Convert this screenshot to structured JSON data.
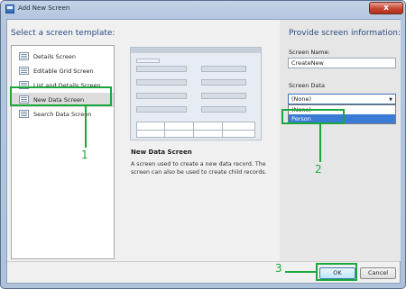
{
  "window": {
    "title": "Add New Screen",
    "close_label": "x"
  },
  "left": {
    "header": "Select a screen template:",
    "templates": [
      {
        "label": "Details Screen",
        "icon": "details-screen-icon"
      },
      {
        "label": "Editable Grid Screen",
        "icon": "grid-screen-icon"
      },
      {
        "label": "List and Details Screen",
        "icon": "list-details-icon"
      },
      {
        "label": "New Data Screen",
        "icon": "new-data-icon"
      },
      {
        "label": "Search Data Screen",
        "icon": "search-data-icon"
      }
    ],
    "selected_index": 3
  },
  "description": {
    "title": "New Data Screen",
    "text": "A screen used to create a new data record.  The screen can also be used to create child records."
  },
  "right": {
    "header": "Provide screen information:",
    "screen_name_label": "Screen Name:",
    "screen_name_value": "CreateNew",
    "screen_data_label": "Screen Data",
    "screen_data_value": "(None)",
    "screen_data_options": [
      "(None)",
      "Person"
    ],
    "highlighted_option": "Person"
  },
  "footer": {
    "ok_label": "OK",
    "cancel_label": "Cancel"
  },
  "annotations": {
    "step1": "1",
    "step2": "2",
    "step3": "3",
    "color": "#1ba83a"
  }
}
